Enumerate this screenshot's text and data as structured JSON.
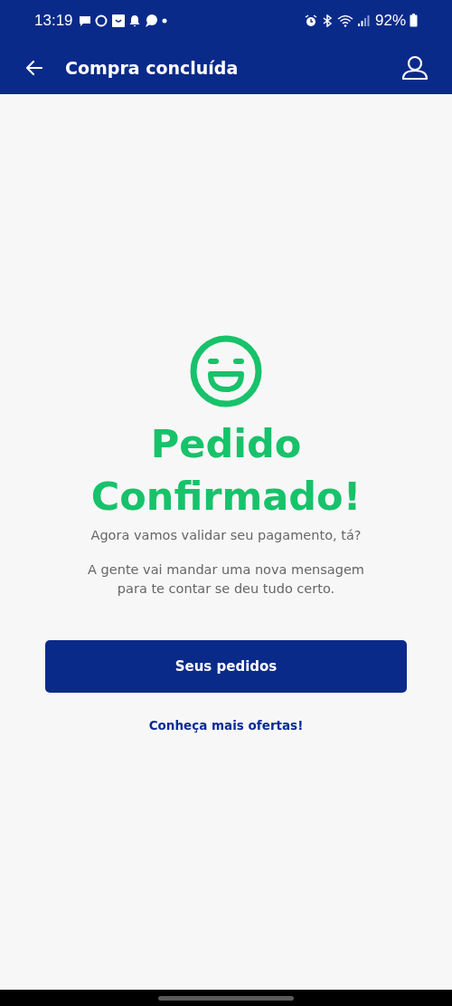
{
  "status_bar": {
    "time": "13:19",
    "battery": "92%"
  },
  "app_bar": {
    "title": "Compra concluída"
  },
  "confirmation": {
    "title_lines": [
      "Pedido",
      "Confirmado!"
    ],
    "subtitle": "Agora vamos validar seu pagamento, tá?",
    "message": "A gente vai mandar uma nova mensagem para te contar se deu tudo certo."
  },
  "buttons": [
    {
      "label": "Seus pedidos",
      "kind": "primary"
    },
    {
      "label": "Conheça mais ofertas!",
      "kind": "link"
    }
  ]
}
